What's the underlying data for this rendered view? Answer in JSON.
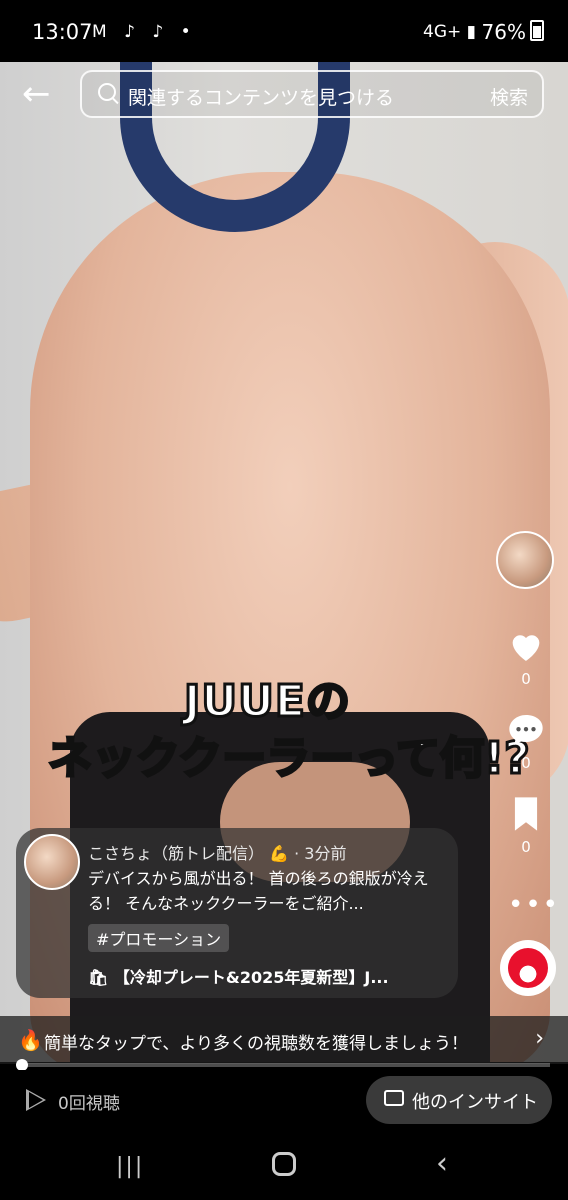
{
  "status_bar": {
    "time": "13:07",
    "left_icons": "M ♪ ♪ •",
    "network": "4G+ ▮",
    "battery": "76%"
  },
  "search": {
    "placeholder": "関連するコンテンツを見つける",
    "button": "検索"
  },
  "video_caption": {
    "line1": "JUUEの",
    "line2": "ネッククーラーって何!?"
  },
  "rail": {
    "like_count": "0",
    "comment_count": "0",
    "bookmark_count": "0",
    "more": "•••"
  },
  "post": {
    "author": "こさちょ（筋トレ配信）",
    "time": "· 3分前",
    "description": "デバイスから風が出る！ 首の後ろの銀版が冷える！ そんなネッククーラーをご紹介...",
    "tag": "#プロモーション",
    "product": "【冷却プレート&2025年夏新型】J..."
  },
  "promo": {
    "text": "簡単なタップで、より多くの視聴数を獲得しましょう！"
  },
  "footer": {
    "views": "0回視聴",
    "insight_label": "他のインサイト"
  },
  "colors": {
    "neck_cooler": "#263a6b",
    "music_disc": "#e8112d"
  }
}
